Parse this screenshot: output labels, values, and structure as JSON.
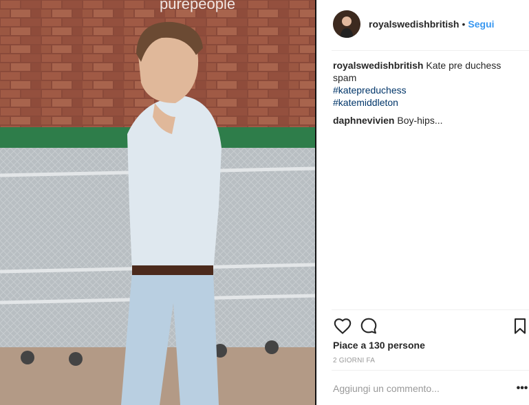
{
  "post": {
    "watermark": "purepeople",
    "username": "royalswedishbritish",
    "dot": "•",
    "follow": "Segui",
    "caption": {
      "username": "royalswedishbritish",
      "text": "Kate pre duchess spam",
      "hashtags": [
        "#katepreduchess",
        "#katemiddleton"
      ]
    },
    "comments": [
      {
        "username": "daphnevivien",
        "text": "Boy-hips..."
      }
    ],
    "likes": "Piace a 130 persone",
    "time": "2 GIORNI FA",
    "add_comment_placeholder": "Aggiungi un commento...",
    "more_label": "•••",
    "icons": {
      "like": "heart-icon",
      "comment": "comment-icon",
      "save": "bookmark-icon"
    }
  }
}
